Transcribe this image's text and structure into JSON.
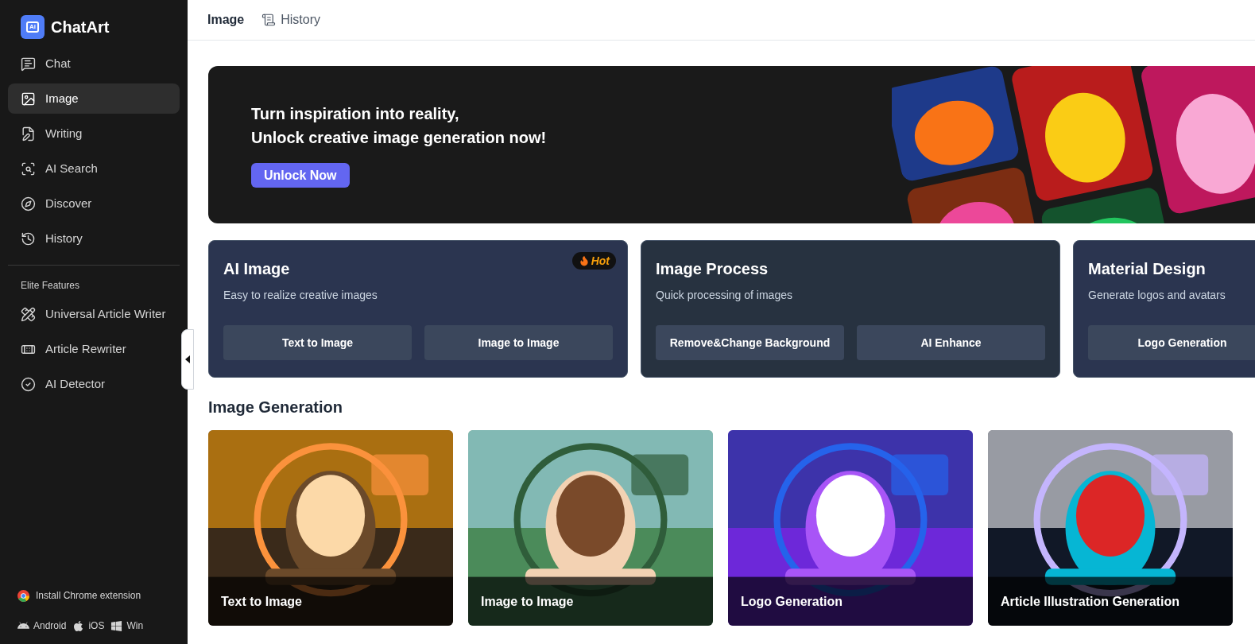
{
  "sidebar": {
    "logo": {
      "mark": "Ai",
      "name": "ChatArt"
    },
    "nav": [
      {
        "label": "Chat",
        "selected": false
      },
      {
        "label": "Image",
        "selected": true
      },
      {
        "label": "Writing",
        "selected": false
      },
      {
        "label": "AI Search",
        "selected": false
      },
      {
        "label": "Discover",
        "selected": false
      },
      {
        "label": "History",
        "selected": false
      }
    ],
    "section_label": "Elite Features",
    "elite": [
      {
        "label": "Universal Article Writer"
      },
      {
        "label": "Article Rewriter"
      },
      {
        "label": "AI Detector"
      }
    ],
    "extension": "Install Chrome extension",
    "platforms": [
      "Android",
      "iOS",
      "Win"
    ]
  },
  "header": {
    "tabs": [
      {
        "label": "Image",
        "selected": true
      },
      {
        "label": "History",
        "selected": false
      }
    ]
  },
  "banner": {
    "lines": [
      "Turn inspiration into reality,",
      "Unlock creative image generation now!"
    ],
    "button": "Unlock Now"
  },
  "feature_cards": [
    {
      "title": "AI Image",
      "subtitle": "Easy to realize creative images",
      "badge": "Hot",
      "buttons": [
        "Text to Image",
        "Image to Image"
      ]
    },
    {
      "title": "Image Process",
      "subtitle": "Quick processing of images",
      "buttons": [
        "Remove&Change Background",
        "AI Enhance"
      ]
    },
    {
      "title": "Material Design",
      "subtitle": "Generate logos and avatars",
      "buttons": [
        "Logo Generation"
      ]
    }
  ],
  "section_title": "Image Generation",
  "gallery": [
    {
      "label": "Text to Image"
    },
    {
      "label": "Image to Image"
    },
    {
      "label": "Logo Generation"
    },
    {
      "label": "Article Illustration Generation"
    }
  ]
}
